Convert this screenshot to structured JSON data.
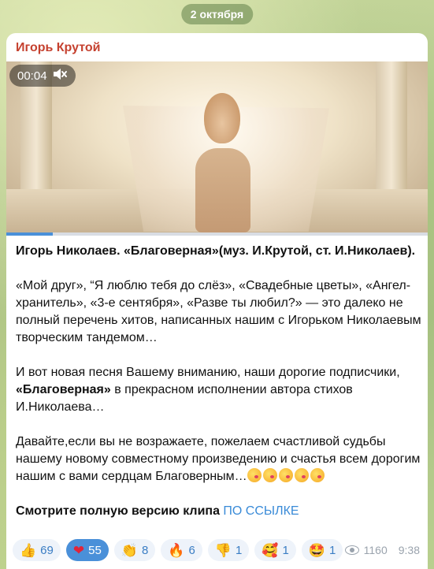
{
  "date": "2 октября",
  "author": "Игорь Крутой",
  "video": {
    "time": "00:04",
    "muted": true,
    "progress": 0.11
  },
  "title_line": "Игорь Николаев. «Благоверная»(муз. И.Крутой, ст. И.Николаев).",
  "p1": "«Мой друг», “Я люблю тебя до слёз», «Свадебные цветы», «Ангел-хранитель», «3-е сентября», «Разве ты любил?» — это далеко не полный перечень хитов, написанных нашим с Игорьком Николаевым творческим тандемом…",
  "p2_start": "И вот новая песня Вашему вниманию, наши дорогие подписчики, ",
  "p2_bold": "«Благоверная»",
  "p2_end": " в прекрасном исполнении автора стихов И.Николаева…",
  "p3": "Давайте,если вы не возражаете, пожелаем счастливой судьбы нашему новому совместному произведению и счастья всем дорогим нашим с вами сердцам Благоверным…",
  "p4_text": "Смотрите полную версию клипа ",
  "p4_link": "ПО ССЫЛКЕ",
  "reactions": [
    {
      "icon": "👍",
      "count": "69",
      "active": false
    },
    {
      "icon": "❤",
      "count": "55",
      "active": true
    },
    {
      "icon": "👏",
      "count": "8",
      "active": false
    },
    {
      "icon": "🔥",
      "count": "6",
      "active": false
    },
    {
      "icon": "👎",
      "count": "1",
      "active": false
    },
    {
      "icon": "🥰",
      "count": "1",
      "active": false
    },
    {
      "icon": "🤩",
      "count": "1",
      "active": false
    }
  ],
  "views": "1160",
  "time": "9:38"
}
